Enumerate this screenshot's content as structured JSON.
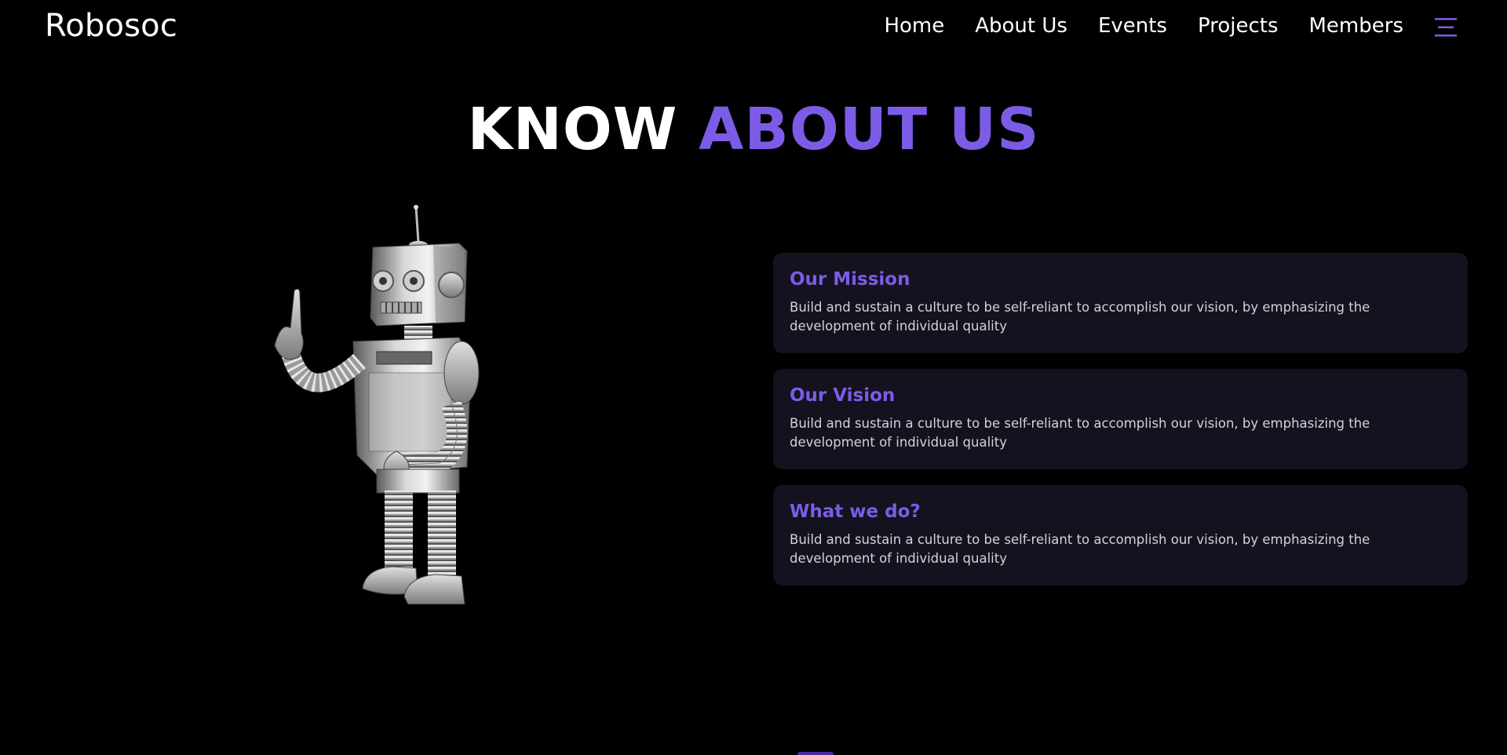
{
  "colors": {
    "accent": "#7c5ce6",
    "background": "#000000",
    "card_background": "#14121f"
  },
  "navbar": {
    "brand": "Robosoc",
    "links": [
      "Home",
      "About Us",
      "Events",
      "Projects",
      "Members"
    ],
    "menu_icon": "hamburger-menu-icon"
  },
  "heading": {
    "part1": "KNOW",
    "part2": "ABOUT US"
  },
  "hero_image": "robot-illustration",
  "cards": [
    {
      "title": "Our Mission",
      "text": "Build and sustain a culture to be self-reliant to accomplish our vision, by emphasizing the development of individual quality"
    },
    {
      "title": "Our Vision",
      "text": "Build and sustain a culture to be self-reliant to accomplish our vision, by emphasizing the development of individual quality"
    },
    {
      "title": "What we do?",
      "text": "Build and sustain a culture to be self-reliant to accomplish our vision, by emphasizing the development of individual quality"
    }
  ]
}
